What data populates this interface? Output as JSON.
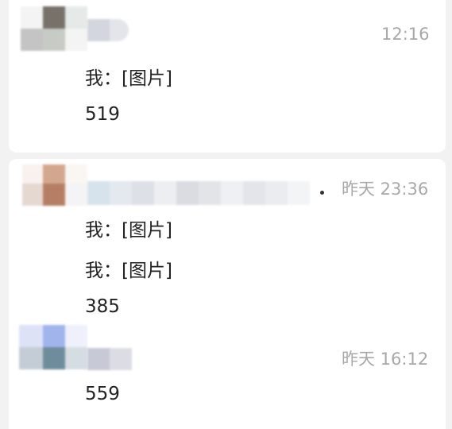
{
  "conversations": [
    {
      "time": "12:16",
      "lines": [
        "我：[图片]",
        "519"
      ]
    },
    {
      "time": "昨天 23:36",
      "lines": [
        "我：[图片]",
        "我：[图片]",
        "385"
      ]
    },
    {
      "time": "昨天 16:12",
      "lines": [
        "559"
      ]
    }
  ],
  "colors": {
    "background": "#f2f2f2",
    "card": "#ffffff",
    "timestamp": "#a8a8a8",
    "text": "#222222"
  }
}
